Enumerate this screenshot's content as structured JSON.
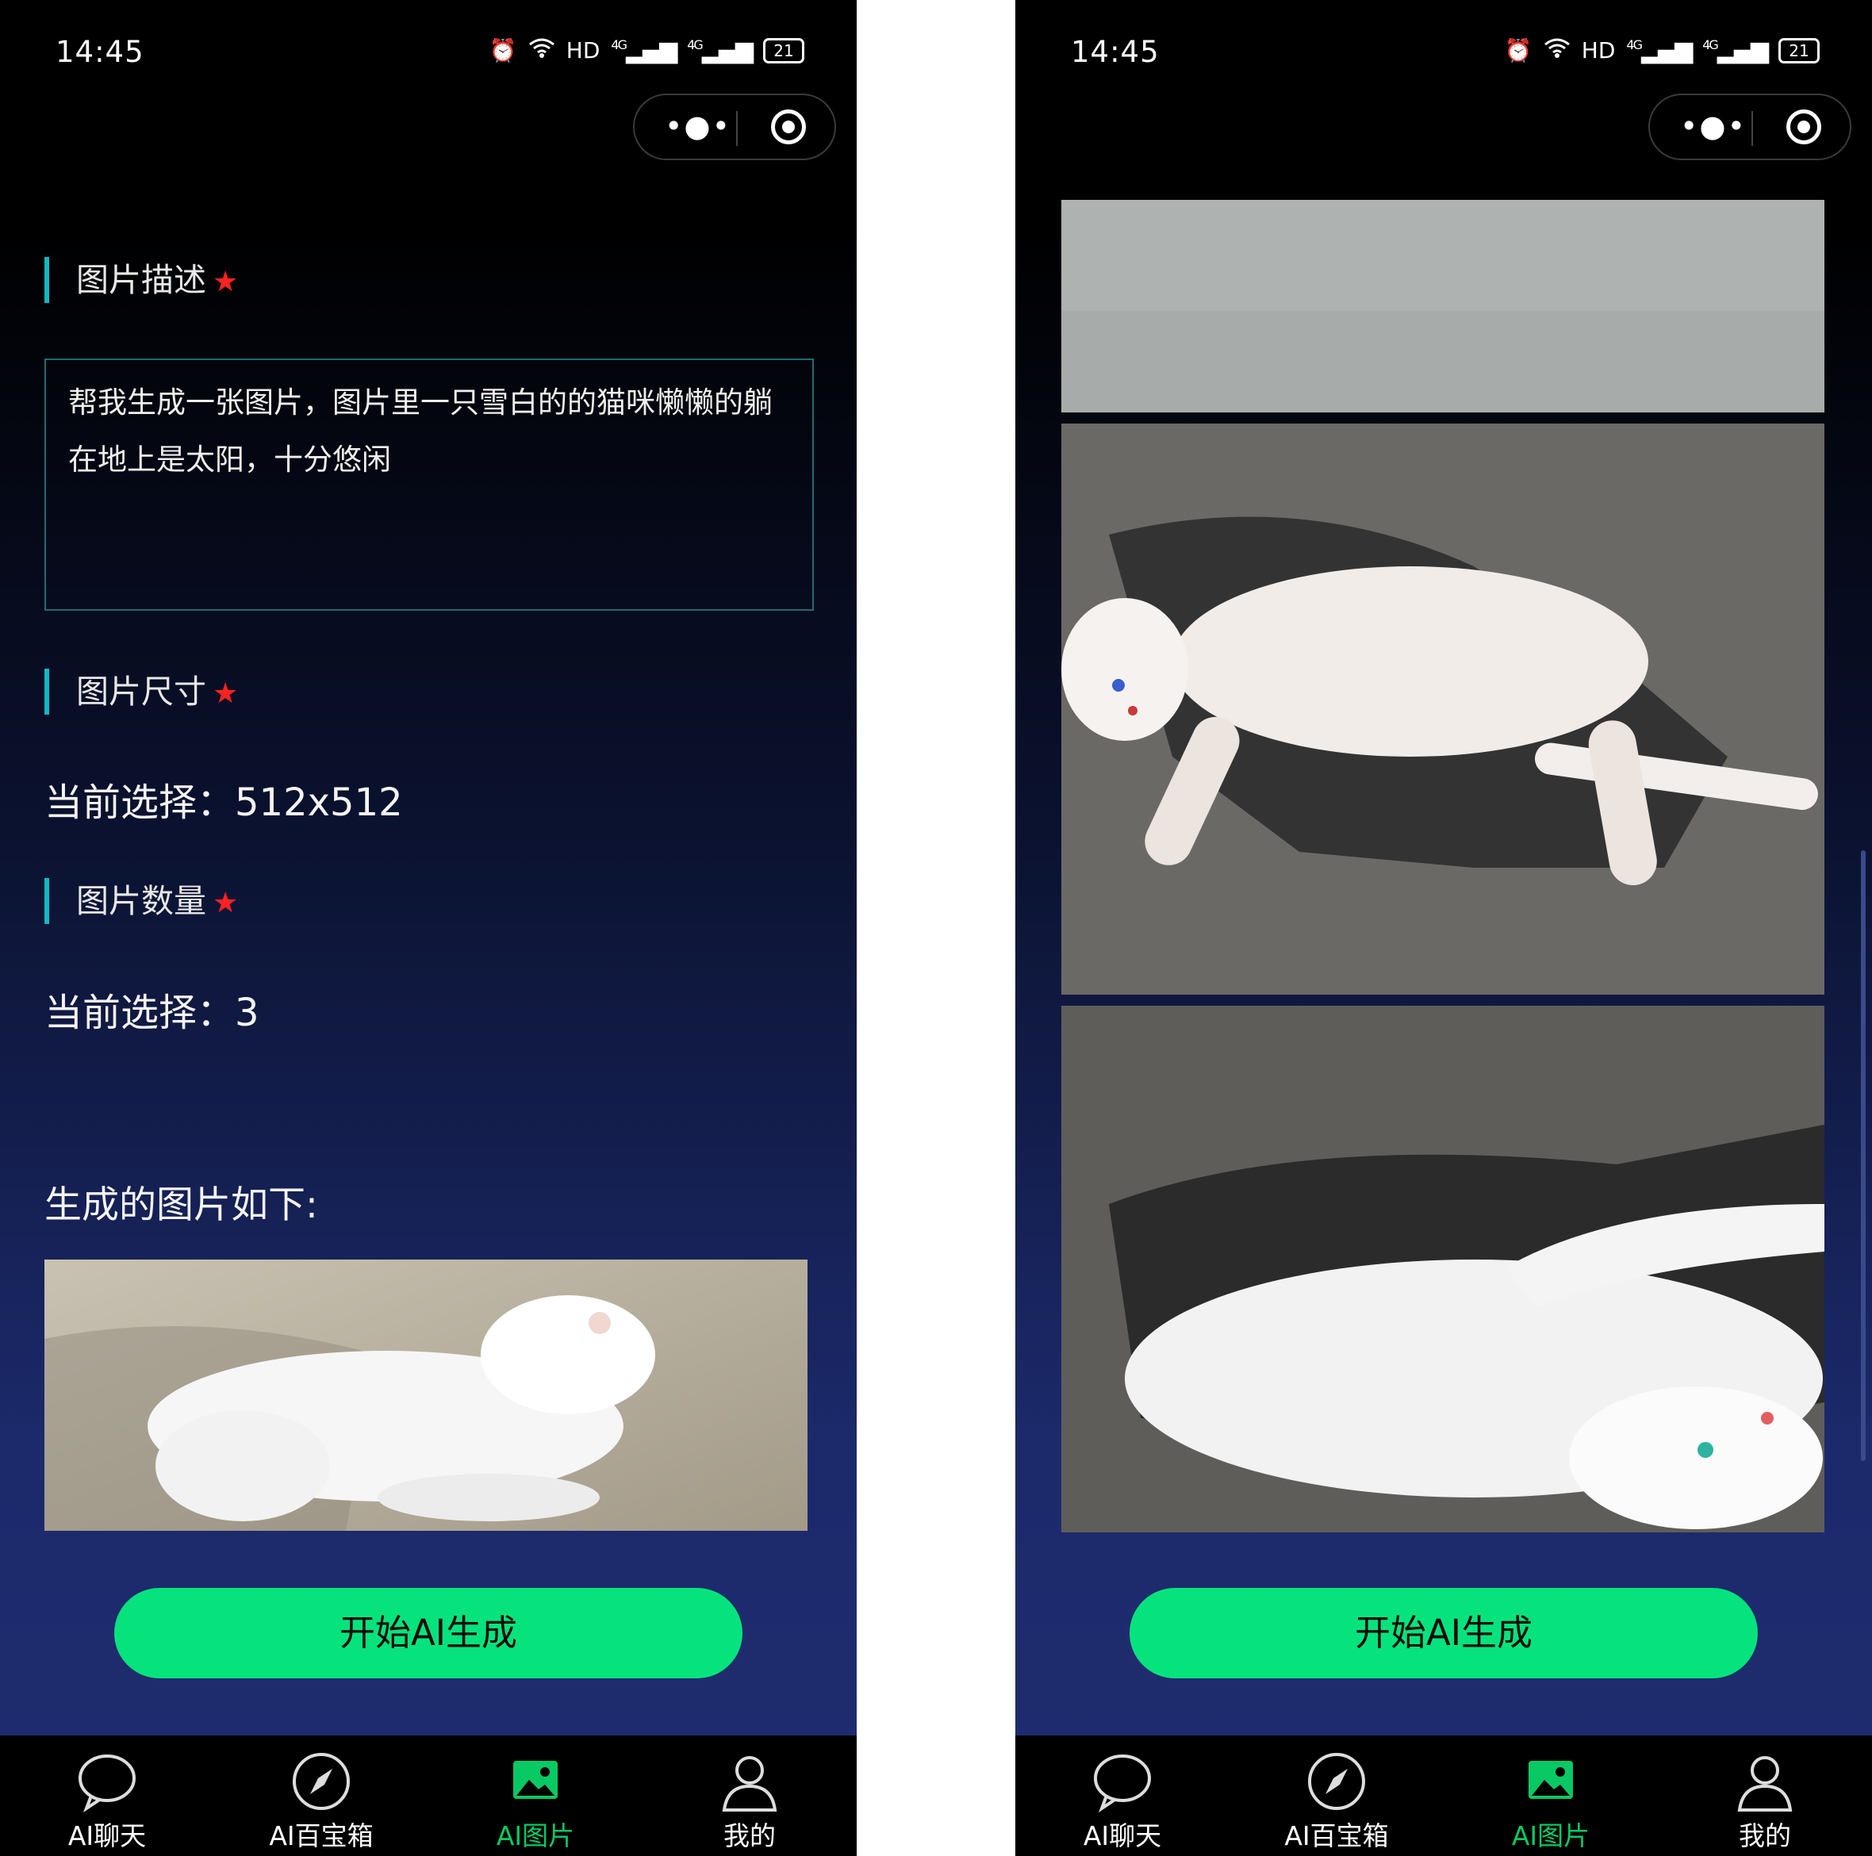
{
  "status": {
    "time": "14:45",
    "network": "HD",
    "sig1": "4G",
    "sig2": "4G",
    "battery": "21"
  },
  "form": {
    "desc_title": "图片描述",
    "size_title": "图片尺寸",
    "count_title": "图片数量",
    "required_mark": "★",
    "description": "帮我生成一张图片，图片里一只雪白的的猫咪懒懒的躺在地上是太阳，十分悠闲",
    "size_current": "当前选择：512x512",
    "count_current": "当前选择：3"
  },
  "result": {
    "title": "生成的图片如下:"
  },
  "button": {
    "generate": "开始AI生成"
  },
  "tabs": [
    {
      "label": "AI聊天",
      "icon": "chat-bubble-icon",
      "active": false
    },
    {
      "label": "AI百宝箱",
      "icon": "compass-icon",
      "active": false
    },
    {
      "label": "AI图片",
      "icon": "image-icon",
      "active": true
    },
    {
      "label": "我的",
      "icon": "user-icon",
      "active": false
    }
  ],
  "colors": {
    "accent_green": "#06e37d",
    "active_tab": "#08c964",
    "section_bar": "#12b7c2",
    "required": "#ff2222"
  }
}
